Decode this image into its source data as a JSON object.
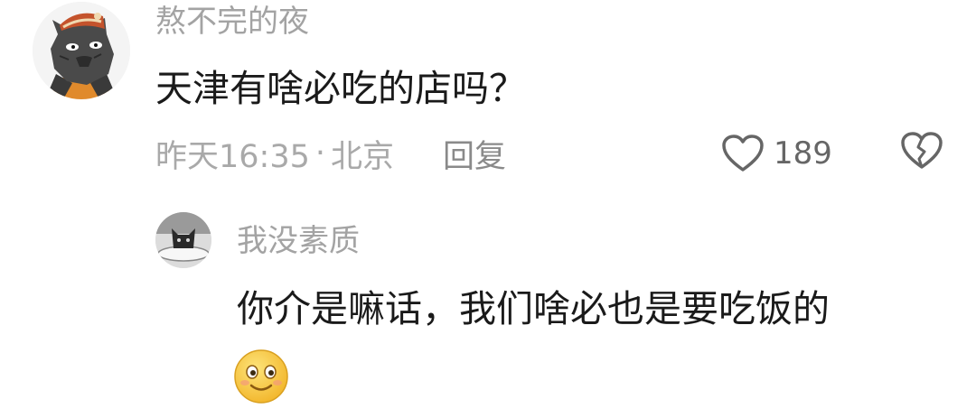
{
  "comment": {
    "avatar_icon": "wolf-avatar-icon",
    "username": "熬不完的夜",
    "text": "天津有啥必吃的店吗？",
    "time": "昨天16:35",
    "separator": "·",
    "location": "北京",
    "reply_label": "回复",
    "like_icon": "heart-outline-icon",
    "like_count": "189",
    "dislike_icon": "broken-heart-icon"
  },
  "reply": {
    "avatar_icon": "cat-avatar-icon",
    "username": "我没素质",
    "text": "你介是嘛话，我们啥必也是要吃饭的",
    "emoji_icon": "smile-emoji-icon"
  },
  "colors": {
    "username": "#a3a3a3",
    "body_text": "#1a1a1a",
    "meta_text": "#a9a9a9",
    "icon_stroke": "#666666",
    "emoji_yellow": "#f5c53b"
  }
}
